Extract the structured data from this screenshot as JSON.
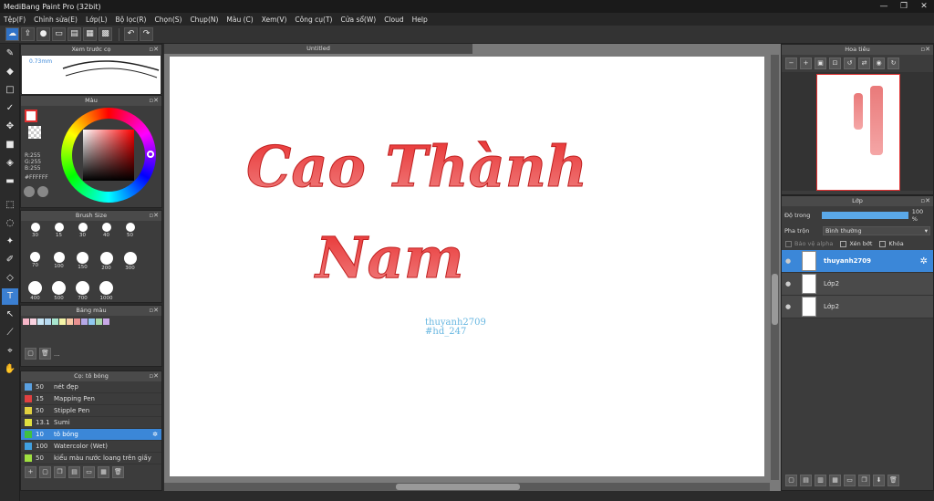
{
  "window": {
    "title": "MediBang Paint Pro (32bit)",
    "minimize": "—",
    "maximize": "❐",
    "close": "✕"
  },
  "menu": [
    "Tệp(F)",
    "Chỉnh sửa(E)",
    "Lớp(L)",
    "Bộ lọc(R)",
    "Chọn(S)",
    "Chụp(N)",
    "Màu (C)",
    "Xem(V)",
    "Công cụ(T)",
    "Cửa sổ(W)",
    "Cloud",
    "Help"
  ],
  "toolbar": {
    "icons": [
      "cloud-icon",
      "export-icon",
      "comment-icon",
      "chat-icon",
      "save-icon",
      "save-as-icon",
      "grid-icon",
      "undo-icon",
      "redo-icon"
    ]
  },
  "brush_preview": {
    "title": "Xem trước cọ",
    "size_label": "0.73mm"
  },
  "color_panel": {
    "title": "Màu",
    "r": "R:255",
    "g": "G:255",
    "b": "B:255",
    "hex": "#FFFFFF"
  },
  "brush_size": {
    "title": "Brush Size",
    "sizes": [
      "30",
      "15",
      "30",
      "40",
      "50",
      "70",
      "100",
      "150",
      "200",
      "300",
      "400",
      "500",
      "700",
      "1000"
    ]
  },
  "palette": {
    "title": "Bảng màu",
    "colors": [
      "#f7b6c8",
      "#f9d2e0",
      "#c8e6f5",
      "#b6d9f0",
      "#a8e6cf",
      "#f5f5a8",
      "#f8c9a6",
      "#e89090",
      "#b5a8e6",
      "#90c8f0",
      "#a8d8a8",
      "#c8a8e6"
    ]
  },
  "brush_list": {
    "title": "Cọ: tô bóng",
    "items": [
      {
        "size": "50",
        "name": "nét đẹp",
        "color": "#5aa0e0"
      },
      {
        "size": "15",
        "name": "Mapping Pen",
        "color": "#e04040"
      },
      {
        "size": "50",
        "name": "Stipple Pen",
        "color": "#e0d040"
      },
      {
        "size": "13.1",
        "name": "Sumi",
        "color": "#e0e040"
      },
      {
        "size": "10",
        "name": "tô bóng",
        "color": "#40c040"
      },
      {
        "size": "100",
        "name": "Watercolor (Wet)",
        "color": "#40a0e0"
      },
      {
        "size": "50",
        "name": "kiểu màu nước loang trên giấy",
        "color": "#a0e040"
      }
    ]
  },
  "document": {
    "tab": "Untitled",
    "text_line1": "Cao Thành",
    "text_line2": "Nam",
    "signature_line1": "thuyanh2709",
    "signature_line2": "#hd_247"
  },
  "navigator": {
    "title": "Hoa tiêu"
  },
  "layers": {
    "title": "Lớp",
    "opacity_label": "Độ trong",
    "opacity_value": "100 %",
    "blend_label": "Pha trộn",
    "blend_value": "Bình thường",
    "protect_alpha": "Bảo vệ alpha",
    "clipping": "Xén bớt",
    "lock": "Khóa",
    "items": [
      {
        "name": "thuyanh2709"
      },
      {
        "name": "Lớp2"
      },
      {
        "name": "Lớp2"
      }
    ]
  }
}
